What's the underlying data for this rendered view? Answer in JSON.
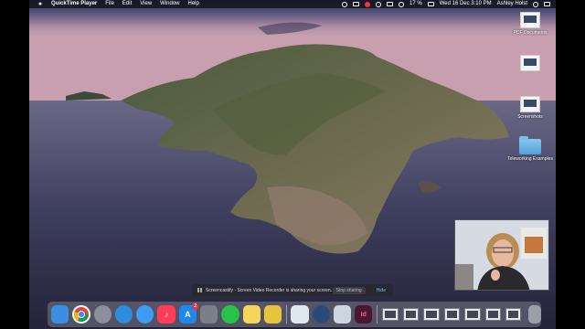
{
  "menubar": {
    "app_name": "QuickTime Player",
    "menus": [
      "File",
      "Edit",
      "View",
      "Window",
      "Help"
    ],
    "battery": "17 %",
    "datetime": "Wed 16 Dec  3:10 PM",
    "user": "Ashley Holst"
  },
  "desktop": {
    "icons": [
      {
        "label": "PDF Documents"
      },
      {
        "label": ""
      },
      {
        "label": "Screenshots"
      },
      {
        "label": "Teleworking Examples"
      }
    ]
  },
  "share_bar": {
    "message": "Screencastify - Screen Video Recorder is sharing your screen.",
    "stop_label": "Stop sharing",
    "hide_label": "Hide"
  },
  "dock": {
    "apps": [
      {
        "name": "finder-icon",
        "color": "#3a8fe0"
      },
      {
        "name": "chrome-icon",
        "color": "#f2f2f2"
      },
      {
        "name": "launchpad-icon",
        "color": "#8a8f99"
      },
      {
        "name": "safari-icon",
        "color": "#2d8be0"
      },
      {
        "name": "messages-icon",
        "color": "#3b9cf5"
      },
      {
        "name": "music-icon",
        "color": "#fb3d57"
      },
      {
        "name": "app-store-icon",
        "color": "#1e88f0",
        "badge": "2"
      },
      {
        "name": "system-preferences-icon",
        "color": "#7a7f88"
      },
      {
        "name": "whatsapp-icon",
        "color": "#28c24a"
      },
      {
        "name": "notes-icon",
        "color": "#f6d65a"
      },
      {
        "name": "stickies-icon",
        "color": "#e7c43b"
      },
      {
        "name": "preview-icon",
        "color": "#dfe7ef"
      },
      {
        "name": "quicktime-icon",
        "color": "#2b4a7a"
      },
      {
        "name": "image-capture-icon",
        "color": "#cdd6de"
      },
      {
        "name": "indesign-icon",
        "color": "#4b1631",
        "text": "Id"
      }
    ]
  }
}
